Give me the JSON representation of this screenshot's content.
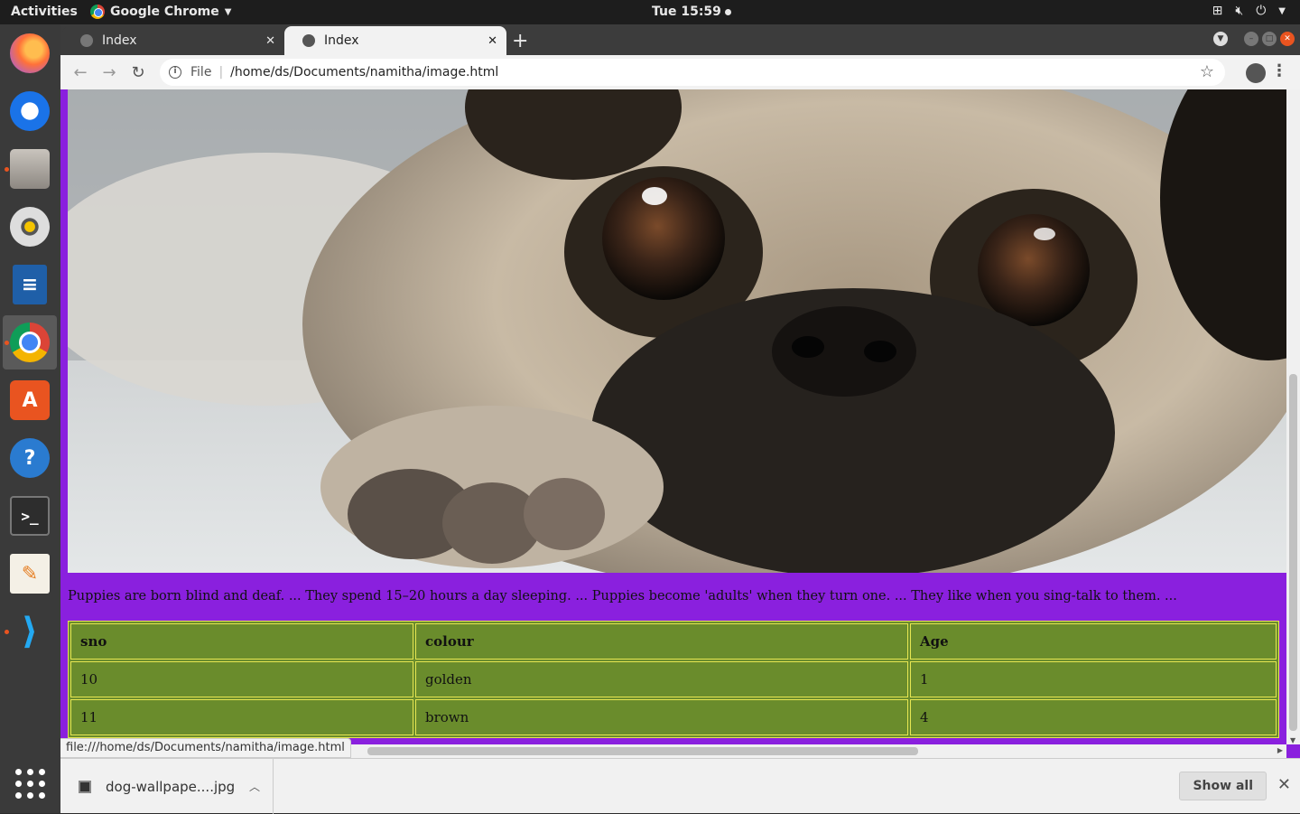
{
  "topbar": {
    "activities": "Activities",
    "app_name": "Google Chrome",
    "clock": "Tue 15:59"
  },
  "dock": {
    "items": [
      {
        "name": "firefox",
        "glyph": ""
      },
      {
        "name": "thunderbird",
        "glyph": ""
      },
      {
        "name": "files",
        "glyph": ""
      },
      {
        "name": "rhythmbox",
        "glyph": ""
      },
      {
        "name": "libreoffice-writer",
        "glyph": ""
      },
      {
        "name": "google-chrome",
        "glyph": ""
      },
      {
        "name": "ubuntu-software",
        "glyph": "A"
      },
      {
        "name": "help",
        "glyph": "?"
      },
      {
        "name": "terminal",
        "glyph": ">_"
      },
      {
        "name": "text-editor",
        "glyph": "✎"
      },
      {
        "name": "vscode",
        "glyph": "⟩"
      }
    ]
  },
  "browser": {
    "tabs": [
      {
        "title": "Index",
        "active": false
      },
      {
        "title": "Index",
        "active": true
      }
    ],
    "url_scheme": "File",
    "url": "/home/ds/Documents/namitha/image.html",
    "status_url": "file:///home/ds/Documents/namitha/image.html"
  },
  "page": {
    "facts": "Puppies are born blind and deaf. ... They spend 15–20 hours a day sleeping. ... Puppies become 'adults' when they turn one. ... They like when you sing-talk to them. ...",
    "table": {
      "headers": [
        "sno",
        "colour",
        "Age"
      ],
      "rows": [
        [
          "10",
          "golden",
          "1"
        ],
        [
          "11",
          "brown",
          "4"
        ]
      ]
    },
    "colors": {
      "page_background": "#8a20de",
      "table_background": "#6a8c2c",
      "table_border": "#e6e652"
    }
  },
  "downloads": {
    "filename": "dog-wallpape....jpg",
    "show_all": "Show all"
  }
}
